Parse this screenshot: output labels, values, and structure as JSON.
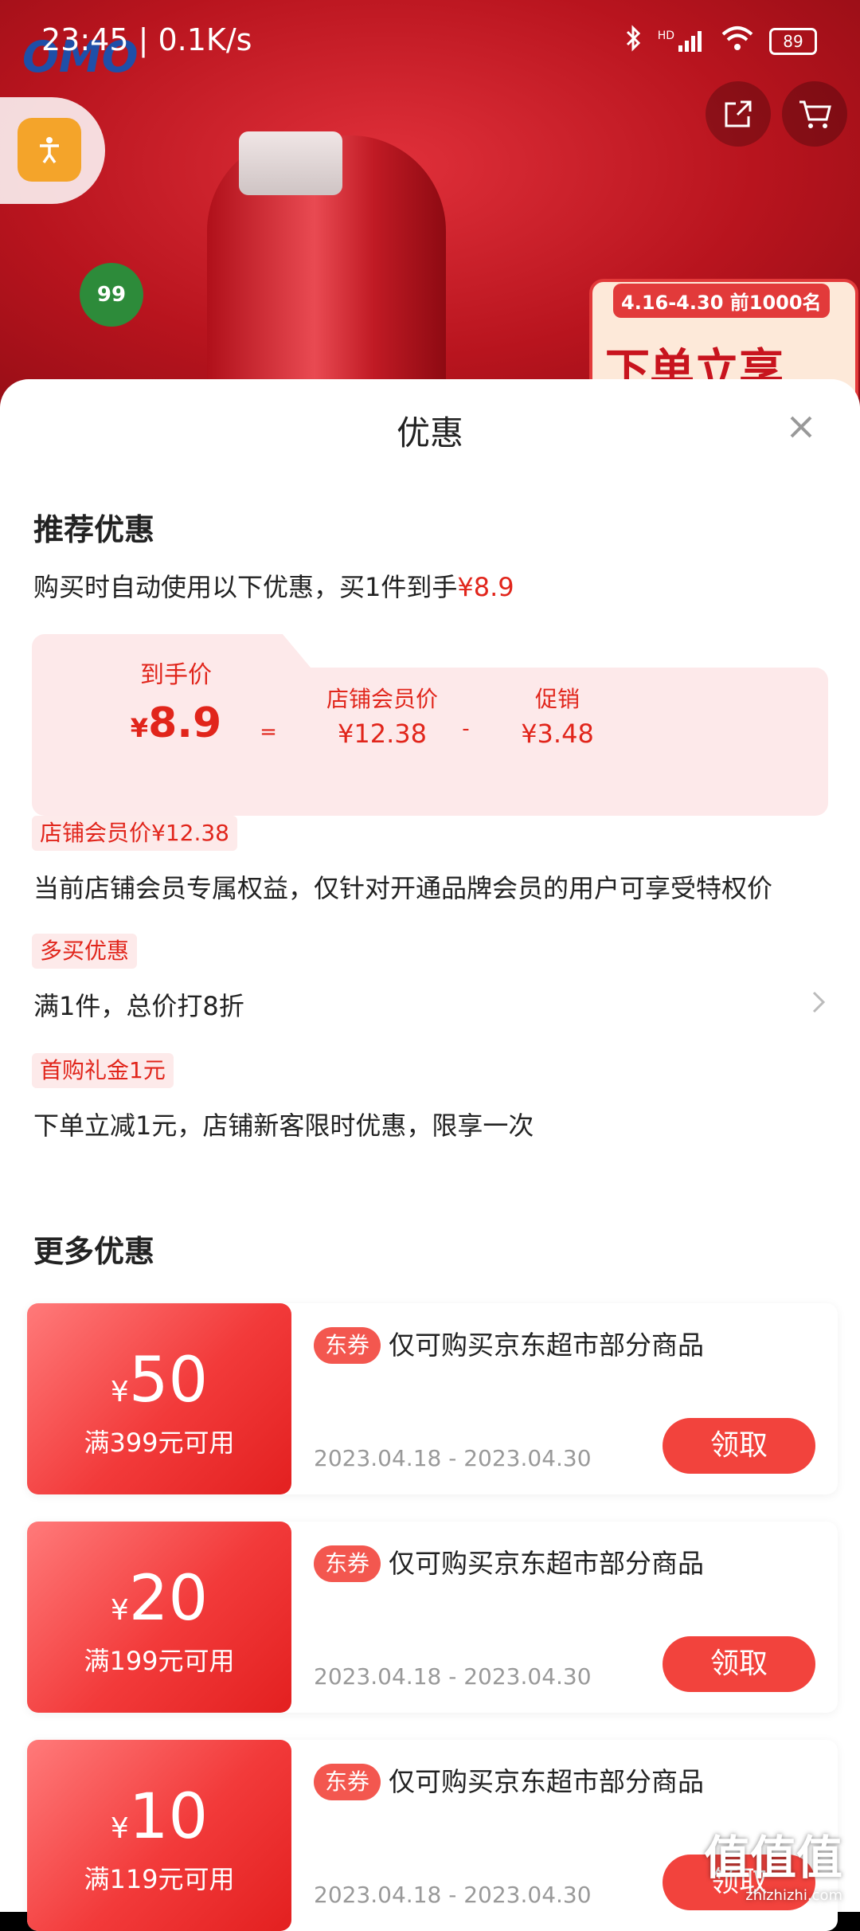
{
  "status_bar": {
    "time": "23:45",
    "net_speed": "| 0.1K/s",
    "battery": "89",
    "signal_label": "HD"
  },
  "background": {
    "brand_logo": "OMO",
    "leaf_badge": "99",
    "promo_dates": "4.16-4.30 前1000名",
    "promo_text": "下单立享"
  },
  "icons": {
    "share": "share-icon",
    "cart": "cart-icon",
    "accessibility": "accessibility-icon",
    "close": "close-icon"
  },
  "sheet": {
    "title": "优惠",
    "recommended": {
      "heading": "推荐优惠",
      "summary_prefix": "购买时自动使用以下优惠，买1件到手",
      "summary_price": "¥8.9",
      "final_label": "到手价",
      "final_yen": "¥",
      "final_value": "8.9",
      "equals": "=",
      "member_label": "店铺会员价",
      "member_value": "¥12.38",
      "minus": "-",
      "promo_label": "促销",
      "promo_value": "¥3.48"
    },
    "benefits": [
      {
        "tag": "店铺会员价¥12.38",
        "text": "当前店铺会员专属权益，仅针对开通品牌会员的用户可享受特权价"
      },
      {
        "tag": "多买优惠",
        "text": "满1件，总价打8折"
      },
      {
        "tag": "首购礼金1元",
        "text": "下单立减1元，店铺新客限时优惠，限享一次"
      }
    ],
    "more_heading": "更多优惠",
    "coupons": [
      {
        "yen": "¥",
        "amount": "50",
        "condition": "满399元可用",
        "badge": "东券",
        "desc": "仅可购买京东超市部分商品",
        "date": "2023.04.18 - 2023.04.30",
        "button": "领取"
      },
      {
        "yen": "¥",
        "amount": "20",
        "condition": "满199元可用",
        "badge": "东券",
        "desc": "仅可购买京东超市部分商品",
        "date": "2023.04.18 - 2023.04.30",
        "button": "领取"
      },
      {
        "yen": "¥",
        "amount": "10",
        "condition": "满119元可用",
        "badge": "东券",
        "desc": "仅可购买京东超市部分商品",
        "date": "2023.04.18 - 2023.04.30",
        "button": "领取"
      }
    ]
  },
  "watermark": {
    "main": "值值值",
    "sub": "zhizhizhi.com"
  }
}
